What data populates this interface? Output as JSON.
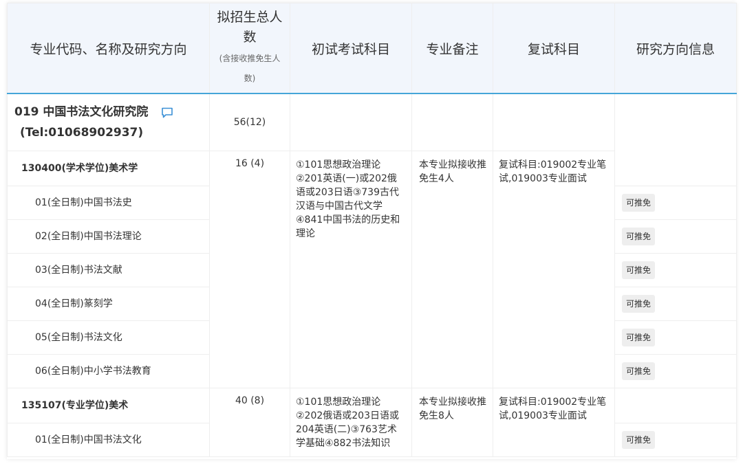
{
  "headers": {
    "code": "专业代码、名称及研究方向",
    "enroll_main": "拟招生总人数",
    "enroll_sub": "(含接收推免生人数)",
    "exam": "初试考试科目",
    "remark": "专业备注",
    "retest": "复试科目",
    "direction_info": "研究方向信息"
  },
  "department": {
    "title": "019 中国书法文化研究院",
    "tel": "(Tel:01068902937)",
    "count": "56(12)",
    "icon": "comment-icon"
  },
  "majors": [
    {
      "name": "130400(学术学位)美术学",
      "count": "16 (4)",
      "exam_subjects": "①101思想政治理论②201英语(一)或202俄语或203日语③739古代汉语与中国古代文学④841中国书法的历史和理论",
      "remark": "本专业拟接收推免生4人",
      "retest": "复试科目:019002专业笔试,019003专业面试",
      "directions": [
        {
          "label": "01(全日制)中国书法史",
          "tag": "可推免"
        },
        {
          "label": "02(全日制)中国书法理论",
          "tag": "可推免"
        },
        {
          "label": "03(全日制)书法文献",
          "tag": "可推免"
        },
        {
          "label": "04(全日制)篆刻学",
          "tag": "可推免"
        },
        {
          "label": "05(全日制)书法文化",
          "tag": "可推免"
        },
        {
          "label": "06(全日制)中小学书法教育",
          "tag": "可推免"
        }
      ]
    },
    {
      "name": "135107(专业学位)美术",
      "count": "40 (8)",
      "exam_subjects": "①101思想政治理论②202俄语或203日语或204英语(二)③763艺术学基础④882书法知识",
      "remark": "本专业拟接收推免生8人",
      "retest": "复试科目:019002专业笔试,019003专业面试",
      "directions": [
        {
          "label": "01(全日制)中国书法文化",
          "tag": "可推免"
        }
      ]
    }
  ],
  "colors": {
    "header_bg": "#f2f6fc",
    "header_border": "#45a5d8",
    "icon": "#3a8fd6",
    "tag_bg": "#eeeeee"
  }
}
